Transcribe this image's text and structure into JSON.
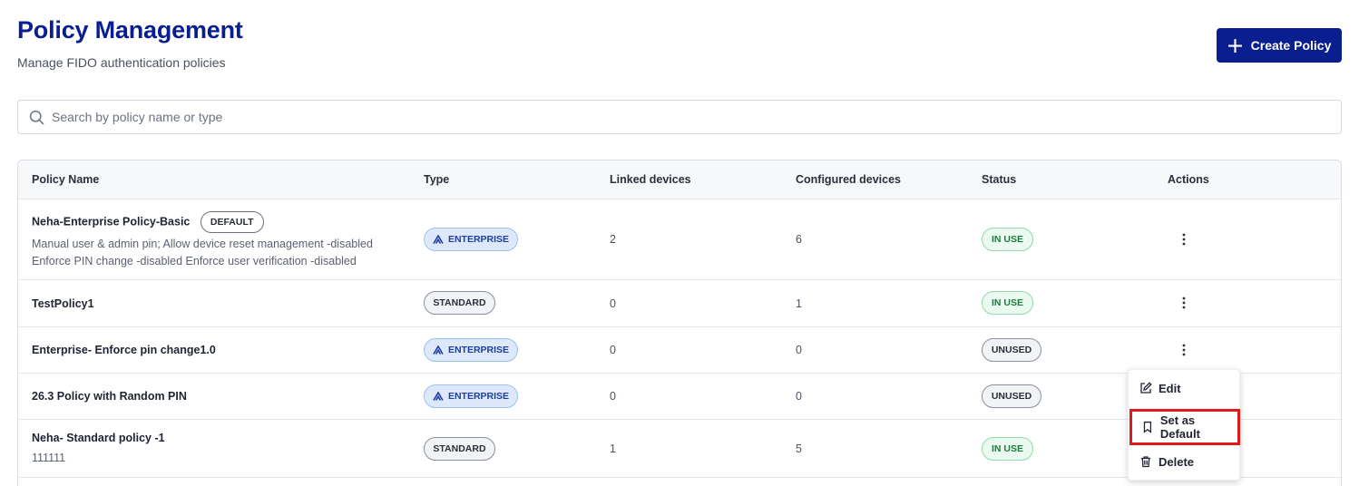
{
  "header": {
    "title": "Policy Management",
    "subtitle": "Manage FIDO authentication policies",
    "create_button_label": "Create Policy"
  },
  "search": {
    "placeholder": "Search by policy name or type",
    "value": ""
  },
  "table": {
    "columns": [
      "Policy Name",
      "Type",
      "Linked devices",
      "Configured devices",
      "Status",
      "Actions"
    ],
    "rows": [
      {
        "name": "Neha-Enterprise Policy-Basic",
        "default_badge": "DEFAULT",
        "description_line1": "Manual user & admin pin; Allow device reset management -disabled",
        "description_line2": "Enforce PIN change -disabled Enforce user verification -disabled",
        "type": "ENTERPRISE",
        "linked": "2",
        "configured": "6",
        "status": "IN USE"
      },
      {
        "name": "TestPolicy1",
        "type": "STANDARD",
        "linked": "0",
        "configured": "1",
        "status": "IN USE"
      },
      {
        "name": "Enterprise- Enforce pin change1.0",
        "type": "ENTERPRISE",
        "linked": "0",
        "configured": "0",
        "status": "UNUSED"
      },
      {
        "name": "26.3 Policy with Random PIN",
        "type": "ENTERPRISE",
        "linked": "0",
        "configured": "0",
        "status": "UNUSED"
      },
      {
        "name": "Neha- Standard policy -1",
        "description_line1": "111111",
        "type": "STANDARD",
        "linked": "1",
        "configured": "5",
        "status": "IN USE"
      }
    ]
  },
  "actions_menu": {
    "items": [
      {
        "label": "Edit",
        "icon": "edit-icon"
      },
      {
        "label": "Set as Default",
        "icon": "bookmark-icon",
        "highlighted": true
      },
      {
        "label": "Delete",
        "icon": "trash-icon"
      }
    ]
  },
  "colors": {
    "brand": "#0a1f8f",
    "highlight_outline": "#e01a1a",
    "in_use_text": "#1f7a3d",
    "enterprise_text": "#1d3ea0"
  }
}
